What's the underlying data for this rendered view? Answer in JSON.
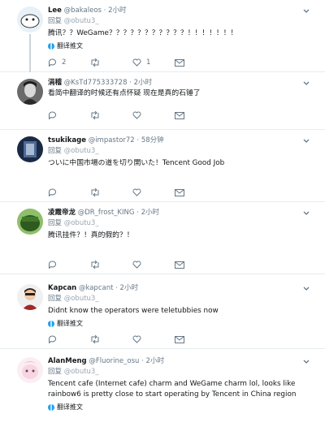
{
  "labels": {
    "reply_prefix": "回复",
    "translate": "翻译推文"
  },
  "tweets": [
    {
      "name": "Lee",
      "handle": "@bakaleos",
      "dot": "·",
      "time": "2小时",
      "mention": "@obutu3_",
      "text": "腾讯？？WeGame？？？？？？？？？？？！！！！！！！",
      "counts": {
        "reply": "2",
        "retweet": "",
        "like": "1"
      }
    },
    {
      "name": "涓稽",
      "handle": "@KsTd775333728",
      "dot": "·",
      "time": "2小时",
      "mention": "",
      "text": "看简中翻译的时候还有点怀疑 现在是真的石锤了",
      "counts": {
        "reply": "",
        "retweet": "",
        "like": ""
      }
    },
    {
      "name": "tsukikage",
      "handle": "@impastor72",
      "dot": "·",
      "time": "58分钟",
      "mention": "@obutu3_",
      "text": "ついに中国市場の道を切り開いた！Tencent Good Job",
      "counts": {
        "reply": "",
        "retweet": "",
        "like": ""
      }
    },
    {
      "name": "凌霞帝龙",
      "handle": "@DR_frost_KING",
      "dot": "·",
      "time": "2小时",
      "mention": "@obutu3_",
      "text": "腾讯挂件？！真的假的？！",
      "counts": {
        "reply": "",
        "retweet": "",
        "like": ""
      }
    },
    {
      "name": "Kapcan",
      "handle": "@kapcant",
      "dot": "·",
      "time": "2小时",
      "mention": "@obutu3_",
      "text": "Didnt know the operators were teletubbies now",
      "counts": {
        "reply": "",
        "retweet": "",
        "like": ""
      }
    },
    {
      "name": "AlanMeng",
      "handle": "@Fluorine_osu",
      "dot": "·",
      "time": "2小时",
      "mention": "@obutu3_",
      "text": "Tencent cafe (Internet cafe) charm and WeGame charm lol, looks like rainbow6 is pretty close to start operating by Tencent in China region",
      "counts": {
        "reply": "",
        "retweet": "",
        "like": ""
      }
    }
  ]
}
